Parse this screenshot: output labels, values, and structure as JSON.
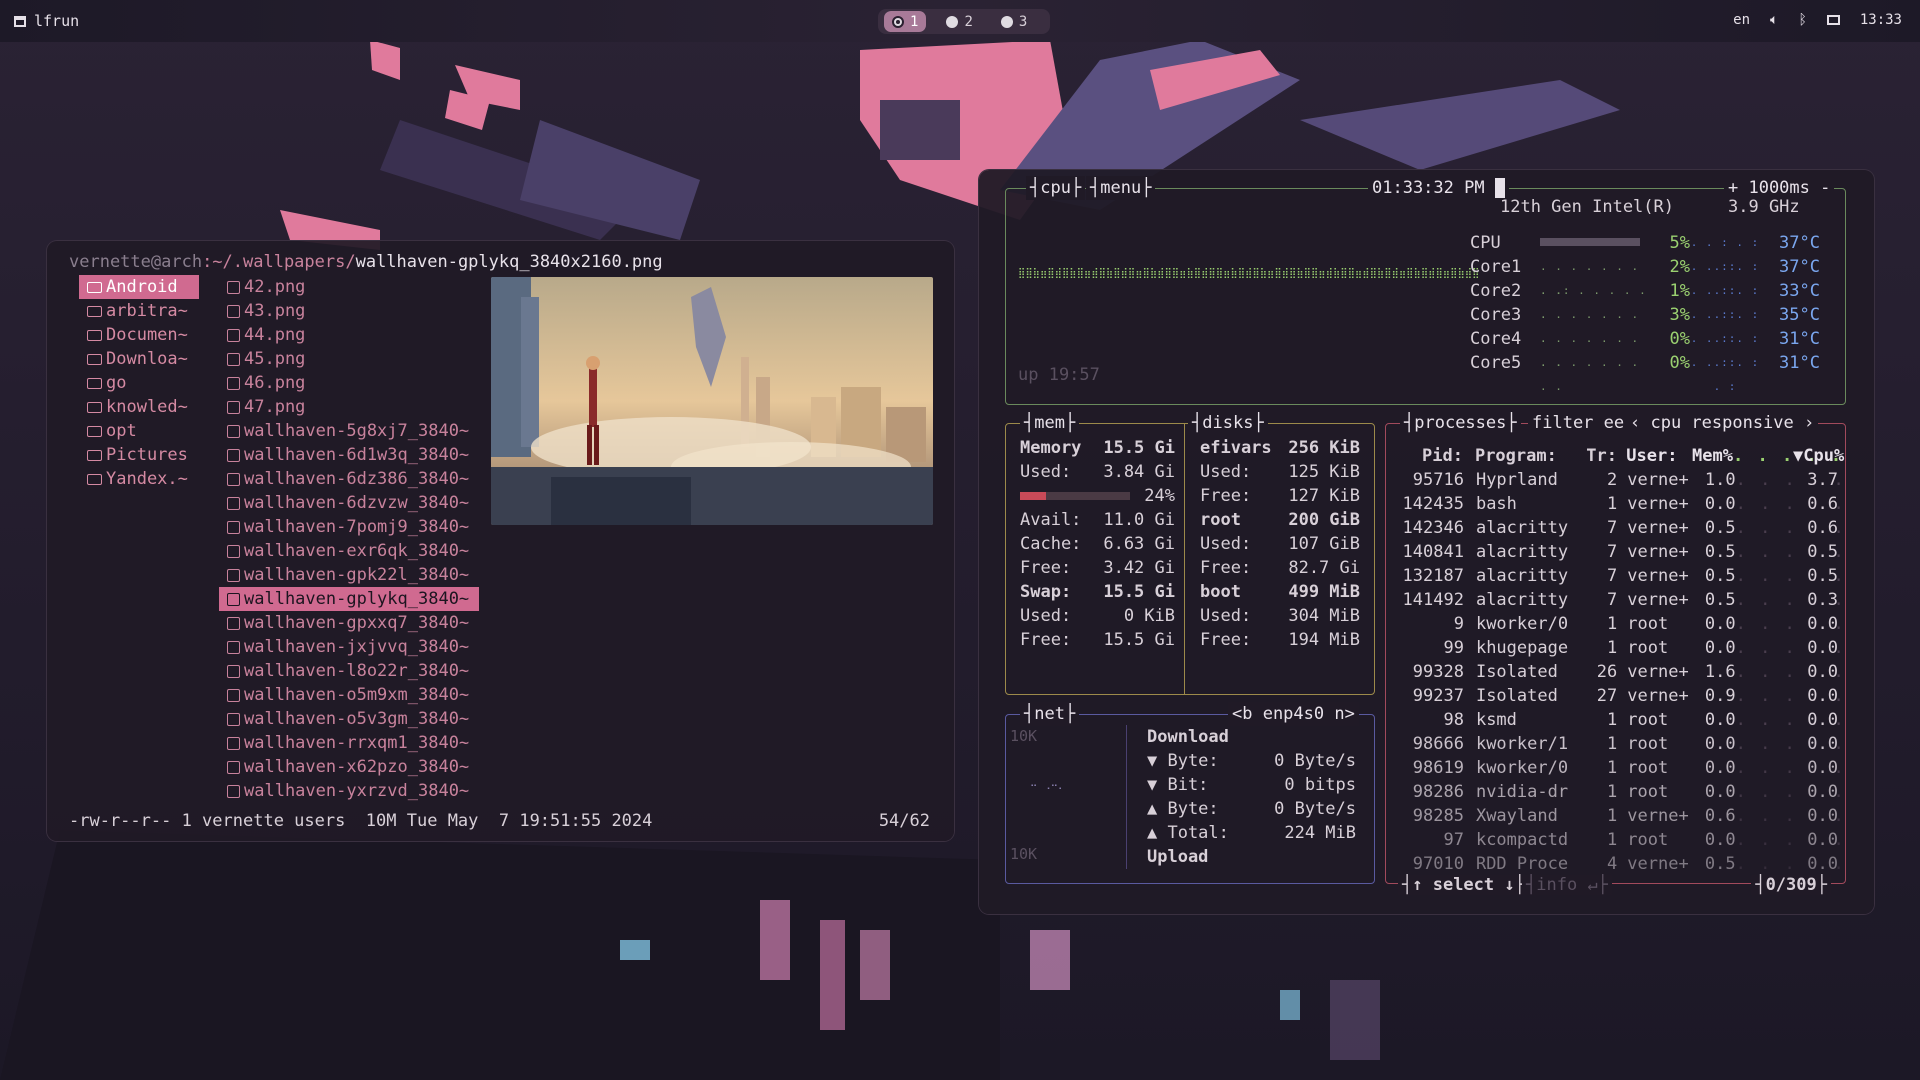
{
  "topbar": {
    "app": "lfrun",
    "workspaces": [
      {
        "label": "1",
        "active": true
      },
      {
        "label": "2",
        "active": false
      },
      {
        "label": "3",
        "active": false
      }
    ],
    "lang": "en",
    "clock": "13:33"
  },
  "lf": {
    "path_user": "vernette@arch",
    "path_dir": ":~/.wallpapers/",
    "path_file": "wallhaven-gplykq_3840x2160.png",
    "dirs": [
      "Android",
      "arbitra~",
      "Documen~",
      "Downloa~",
      "go",
      "knowled~",
      "opt",
      "Pictures",
      "Yandex.~"
    ],
    "files": [
      "42.png",
      "43.png",
      "44.png",
      "45.png",
      "46.png",
      "47.png",
      "wallhaven-5g8xj7_3840~",
      "wallhaven-6d1w3q_3840~",
      "wallhaven-6dz386_3840~",
      "wallhaven-6dzvzw_3840~",
      "wallhaven-7pomj9_3840~",
      "wallhaven-exr6qk_3840~",
      "wallhaven-gpk22l_3840~",
      "wallhaven-gplykq_3840~",
      "wallhaven-gpxxq7_3840~",
      "wallhaven-jxjvvq_3840~",
      "wallhaven-l8o22r_3840~",
      "wallhaven-o5m9xm_3840~",
      "wallhaven-o5v3gm_3840~",
      "wallhaven-rrxqm1_3840~",
      "wallhaven-x62pzo_3840~",
      "wallhaven-yxrzvd_3840~"
    ],
    "selected_file_index": 13,
    "status_left": "-rw-r--r-- 1 vernette users  10M Tue May  7 19:51:55 2024",
    "status_right": "54/62"
  },
  "btop": {
    "cpu_title": "cpu",
    "menu_title": "menu",
    "time": "01:33:32 PM",
    "interval": "+ 1000ms -",
    "cpu_model": "12th Gen Intel(R)",
    "freq": "3.9 GHz",
    "uptime": "up 19:57",
    "cores": [
      {
        "name": "CPU",
        "pct": "5%",
        "temp": "37°C"
      },
      {
        "name": "Core1",
        "pct": "2%",
        "temp": "37°C"
      },
      {
        "name": "Core2",
        "pct": "1%",
        "temp": "33°C"
      },
      {
        "name": "Core3",
        "pct": "3%",
        "temp": "35°C"
      },
      {
        "name": "Core4",
        "pct": "0%",
        "temp": "31°C"
      },
      {
        "name": "Core5",
        "pct": "0%",
        "temp": "31°C"
      }
    ],
    "mem_title": "mem",
    "mem": {
      "memory_label": "Memory",
      "memory": "15.5 Gi",
      "used_label": "Used:",
      "used": "3.84 Gi",
      "used_pct": "24%",
      "used_fraction": 0.24,
      "avail_label": "Avail:",
      "avail": "11.0 Gi",
      "cache_label": "Cache:",
      "cache": "6.63 Gi",
      "free_label": "Free:",
      "free": "3.42 Gi",
      "swap_label": "Swap:",
      "swap": "15.5 Gi",
      "swap_used_label": "Used:",
      "swap_used": "0 KiB",
      "swap_free_label": "Free:",
      "swap_free": "15.5 Gi"
    },
    "disks_title": "disks",
    "disks": [
      {
        "name": "efivars",
        "size": "256 KiB",
        "used": "125 KiB",
        "free": "127 KiB"
      },
      {
        "name": "root",
        "size": "200 GiB",
        "used": "107 GiB",
        "free": "82.7 Gi"
      },
      {
        "name": "boot",
        "size": "499 MiB",
        "used": "304 MiB",
        "free": "194 MiB"
      }
    ],
    "net_title": "net",
    "net_iface": "<b enp4s0 n>",
    "net_scale_top": "10K",
    "net_scale_bottom": "10K",
    "net": {
      "download": "Download",
      "d_byte_label": "▼ Byte:",
      "d_byte": "0 Byte/s",
      "d_bit_label": "▼ Bit:",
      "d_bit": "0 bitps",
      "u_byte_label": "▲ Byte:",
      "u_byte": "0 Byte/s",
      "u_total_label": "▲ Total:",
      "u_total": "224 MiB",
      "upload": "Upload"
    },
    "proc_title": "processes",
    "proc_filter": "filter",
    "proc_filter_val": "ee",
    "proc_sort": "‹ cpu responsive ›",
    "proc_headers": {
      "pid": "Pid:",
      "prog": "Program:",
      "tr": "Tr:",
      "user": "User:",
      "mem": "Mem%",
      "cpu": "▼Cpu%"
    },
    "processes": [
      {
        "pid": "95716",
        "prog": "Hyprland",
        "tr": "2",
        "user": "verne+",
        "mem": "1.0",
        "cpu": "3.7"
      },
      {
        "pid": "142435",
        "prog": "bash",
        "tr": "1",
        "user": "verne+",
        "mem": "0.0",
        "cpu": "0.6"
      },
      {
        "pid": "142346",
        "prog": "alacritty",
        "tr": "7",
        "user": "verne+",
        "mem": "0.5",
        "cpu": "0.6"
      },
      {
        "pid": "140841",
        "prog": "alacritty",
        "tr": "7",
        "user": "verne+",
        "mem": "0.5",
        "cpu": "0.5"
      },
      {
        "pid": "132187",
        "prog": "alacritty",
        "tr": "7",
        "user": "verne+",
        "mem": "0.5",
        "cpu": "0.5"
      },
      {
        "pid": "141492",
        "prog": "alacritty",
        "tr": "7",
        "user": "verne+",
        "mem": "0.5",
        "cpu": "0.3"
      },
      {
        "pid": "9",
        "prog": "kworker/0",
        "tr": "1",
        "user": "root",
        "mem": "0.0",
        "cpu": "0.0"
      },
      {
        "pid": "99",
        "prog": "khugepage",
        "tr": "1",
        "user": "root",
        "mem": "0.0",
        "cpu": "0.0"
      },
      {
        "pid": "99328",
        "prog": "Isolated",
        "tr": "26",
        "user": "verne+",
        "mem": "1.6",
        "cpu": "0.0"
      },
      {
        "pid": "99237",
        "prog": "Isolated",
        "tr": "27",
        "user": "verne+",
        "mem": "0.9",
        "cpu": "0.0"
      },
      {
        "pid": "98",
        "prog": "ksmd",
        "tr": "1",
        "user": "root",
        "mem": "0.0",
        "cpu": "0.0"
      },
      {
        "pid": "98666",
        "prog": "kworker/1",
        "tr": "1",
        "user": "root",
        "mem": "0.0",
        "cpu": "0.0"
      },
      {
        "pid": "98619",
        "prog": "kworker/0",
        "tr": "1",
        "user": "root",
        "mem": "0.0",
        "cpu": "0.0"
      },
      {
        "pid": "98286",
        "prog": "nvidia-dr",
        "tr": "1",
        "user": "root",
        "mem": "0.0",
        "cpu": "0.0"
      },
      {
        "pid": "98285",
        "prog": "Xwayland",
        "tr": "1",
        "user": "verne+",
        "mem": "0.6",
        "cpu": "0.0"
      },
      {
        "pid": "97",
        "prog": "kcompactd",
        "tr": "1",
        "user": "root",
        "mem": "0.0",
        "cpu": "0.0"
      },
      {
        "pid": "97010",
        "prog": "RDD Proce",
        "tr": "4",
        "user": "verne+",
        "mem": "0.5",
        "cpu": "0.0"
      }
    ],
    "proc_select": "↑ select ↓",
    "proc_info": "info ↵",
    "proc_count": "0/309"
  }
}
